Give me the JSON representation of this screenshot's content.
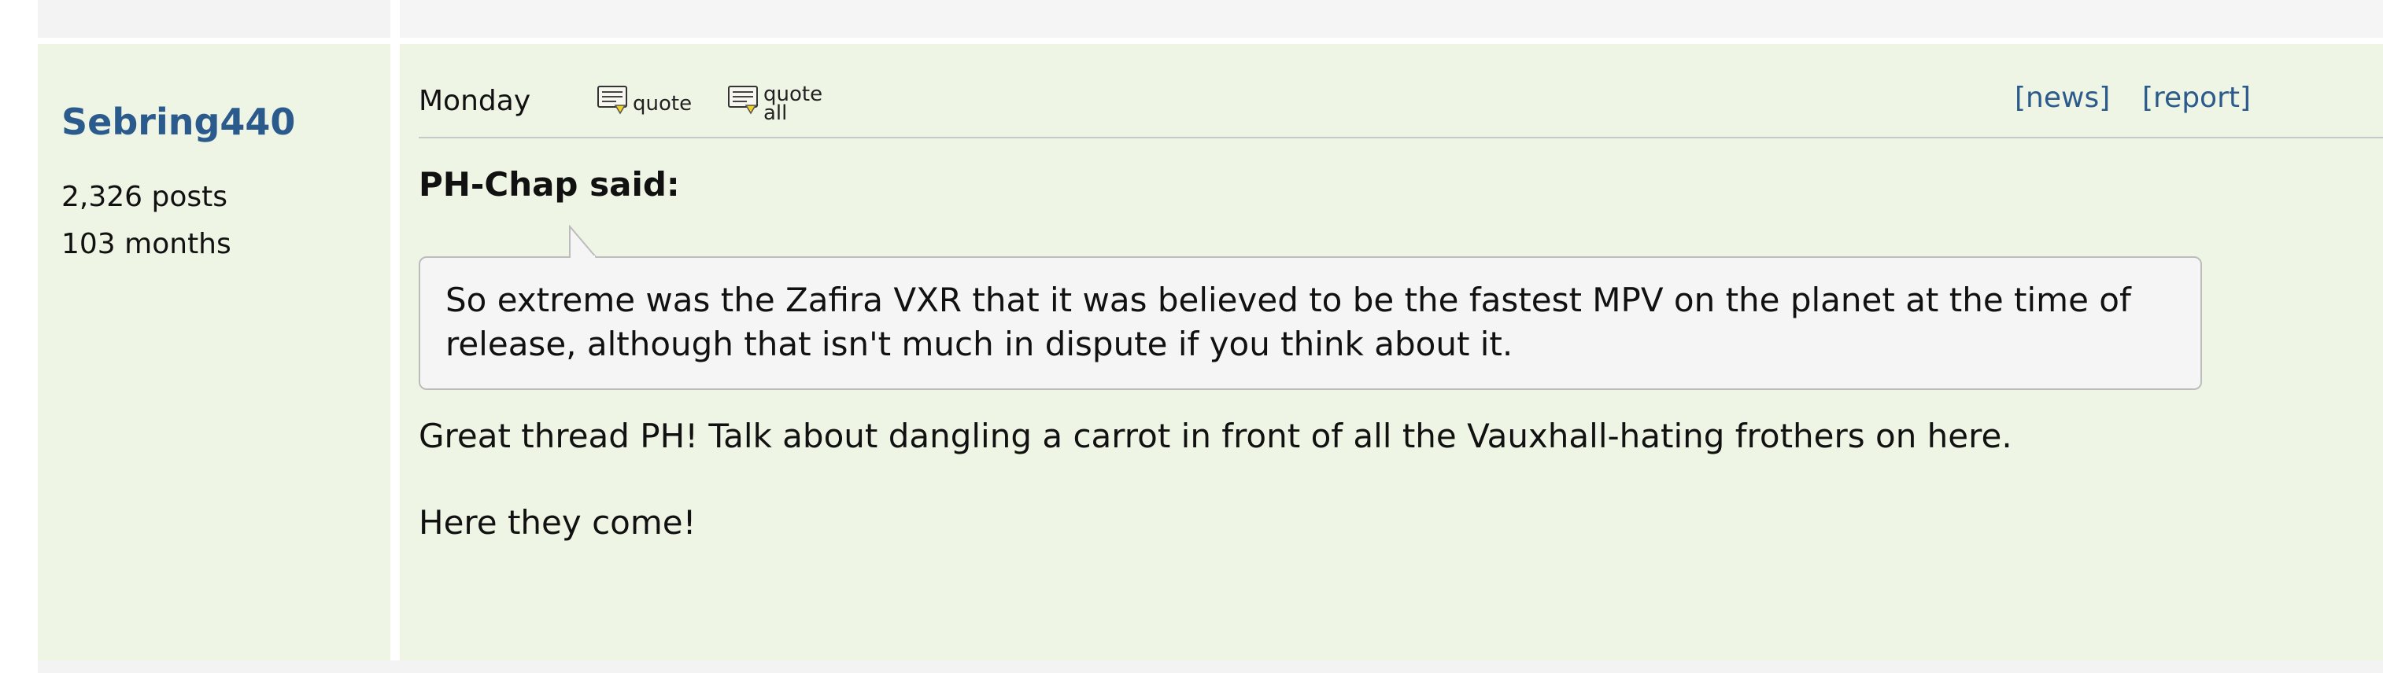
{
  "post": {
    "author": {
      "username": "Sebring440",
      "posts": "2,326 posts",
      "months": "103 months"
    },
    "date": "Monday",
    "actions": {
      "quote_label": "quote",
      "quote_all_line1": "quote",
      "quote_all_line2": "all",
      "news_label": "[news]",
      "report_label": "[report]"
    },
    "quoted": {
      "attribution": "PH-Chap said:",
      "text": "So extreme was the Zafira VXR that it was believed to be the fastest MPV on the planet at the time of release, although that isn't much in dispute if you think about it."
    },
    "body": [
      "Great thread PH! Talk about dangling a carrot in front of all the Vauxhall-hating frothers on here.",
      "Here they come!"
    ]
  },
  "colors": {
    "post_background": "#eff5e4",
    "username": "#2b5a8c",
    "link": "#2b5a8c",
    "quote_background": "#f5f5f5"
  }
}
